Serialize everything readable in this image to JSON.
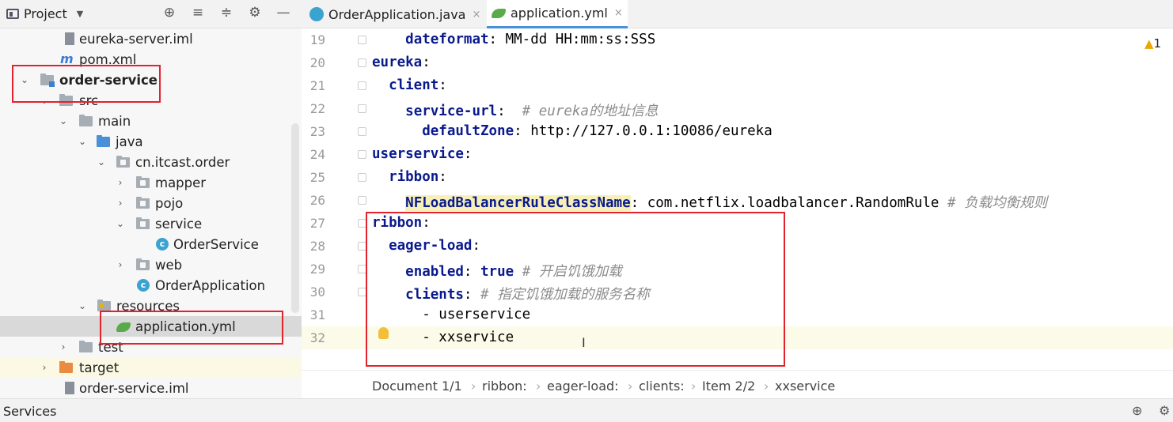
{
  "project_header": {
    "title": "Project",
    "icons": [
      "target-icon",
      "expand-all-icon",
      "collapse-all-icon",
      "gear-icon",
      "minimize-icon"
    ],
    "icon_glyphs": [
      "⊕",
      "≡",
      "≑",
      "⚙",
      "—"
    ]
  },
  "tree": [
    {
      "label": "eureka-server.iml",
      "icon": "iml-file-icon"
    },
    {
      "label": "pom.xml",
      "icon": "maven-icon",
      "icon_glyph": "m"
    },
    {
      "label": "order-service",
      "icon": "module-folder-icon",
      "expanded": true
    },
    {
      "label": "src",
      "icon": "folder-icon",
      "expanded": true
    },
    {
      "label": "main",
      "icon": "folder-icon",
      "expanded": true
    },
    {
      "label": "java",
      "icon": "source-folder-icon",
      "expanded": true
    },
    {
      "label": "cn.itcast.order",
      "icon": "package-icon",
      "expanded": true
    },
    {
      "label": "mapper",
      "icon": "package-icon",
      "expanded": false
    },
    {
      "label": "pojo",
      "icon": "package-icon",
      "expanded": false
    },
    {
      "label": "service",
      "icon": "package-icon",
      "expanded": true
    },
    {
      "label": "OrderService",
      "icon": "class-icon",
      "icon_glyph": "c"
    },
    {
      "label": "web",
      "icon": "package-icon",
      "expanded": false
    },
    {
      "label": "OrderApplication",
      "icon": "spring-class-icon",
      "icon_glyph": "c"
    },
    {
      "label": "resources",
      "icon": "resources-folder-icon",
      "expanded": true
    },
    {
      "label": "application.yml",
      "icon": "yaml-file-icon",
      "selected": true
    },
    {
      "label": "test",
      "icon": "folder-icon",
      "expanded": false
    },
    {
      "label": "target",
      "icon": "excluded-folder-icon",
      "expanded": false
    },
    {
      "label": "order-service.iml",
      "icon": "iml-file-icon"
    }
  ],
  "tabs": [
    {
      "label": "OrderApplication.java",
      "icon": "java-class-icon",
      "close": "×",
      "active": false
    },
    {
      "label": "application.yml",
      "icon": "yaml-file-icon",
      "close": "×",
      "active": true
    }
  ],
  "editor": {
    "warning_count": "1",
    "warning_glyph": "▲",
    "current_line": 32,
    "lines": [
      {
        "num": "19",
        "indent": "    ",
        "key": "dateformat",
        "rest": ": MM-dd HH:mm:ss:SSS",
        "comment": ""
      },
      {
        "num": "20",
        "indent": "",
        "key": "eureka",
        "rest": ":",
        "comment": ""
      },
      {
        "num": "21",
        "indent": "  ",
        "key": "client",
        "rest": ":",
        "comment": ""
      },
      {
        "num": "22",
        "indent": "    ",
        "key": "service-url",
        "rest": ":  ",
        "comment": "# eureka的地址信息"
      },
      {
        "num": "23",
        "indent": "      ",
        "key": "defaultZone",
        "rest": ": http://127.0.0.1:10086/eureka",
        "comment": ""
      },
      {
        "num": "24",
        "indent": "",
        "key": "userservice",
        "rest": ":",
        "comment": ""
      },
      {
        "num": "25",
        "indent": "  ",
        "key": "ribbon",
        "rest": ":",
        "comment": ""
      },
      {
        "num": "26",
        "indent": "    ",
        "key": "NFLoadBalancerRuleClassName",
        "rest": ": com.netflix.loadbalancer.RandomRule ",
        "comment": "# 负载均衡规则",
        "highlight": true
      },
      {
        "num": "27",
        "indent": "",
        "key": "ribbon",
        "rest": ":",
        "comment": ""
      },
      {
        "num": "28",
        "indent": "  ",
        "key": "eager-load",
        "rest": ":",
        "comment": ""
      },
      {
        "num": "29",
        "indent": "    ",
        "key": "enabled",
        "rest": ": ",
        "value": "true",
        "comment": " # 开启饥饿加载"
      },
      {
        "num": "30",
        "indent": "    ",
        "key": "clients",
        "rest": ": ",
        "comment": "# 指定饥饿加载的服务名称"
      },
      {
        "num": "31",
        "indent": "      ",
        "key": "",
        "rest": "- userservice",
        "comment": ""
      },
      {
        "num": "32",
        "indent": "      ",
        "key": "",
        "rest": "- xxservice",
        "comment": ""
      }
    ]
  },
  "breadcrumb": [
    "Document 1/1",
    "ribbon:",
    "eager-load:",
    "clients:",
    "Item 2/2",
    "xxservice"
  ],
  "breadcrumb_separator": "›",
  "status_bar": {
    "label": "Services",
    "icons": [
      "globe-icon",
      "settings-icon"
    ],
    "icon_glyphs": [
      "⊕",
      "⚙"
    ]
  },
  "colors": {
    "annotation_red": "#e2222d",
    "keyword_blue": "#0a1a8c",
    "comment_gray": "#8c8c8c",
    "selection_gray": "#d9d9d9"
  }
}
